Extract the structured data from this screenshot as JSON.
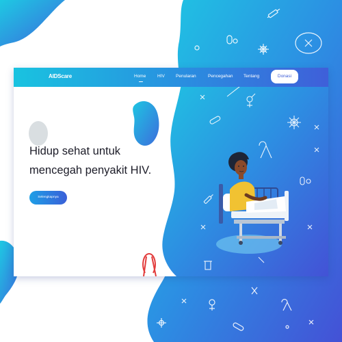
{
  "navbar": {
    "logo": "AIDScare",
    "items": [
      {
        "label": "Home"
      },
      {
        "label": "HIV"
      },
      {
        "label": "Penularan"
      },
      {
        "label": "Pencegahan"
      },
      {
        "label": "Tentang"
      }
    ],
    "donate_label": "Donasi"
  },
  "hero": {
    "headline_line1": "Hidup sehat untuk",
    "headline_line2": "mencegah penyakit HIV.",
    "cta_label": "Selengkapnya"
  },
  "colors": {
    "primary_gradient_start": "#19c3e0",
    "primary_gradient_end": "#3f5fd9",
    "ribbon_red": "#e23b3b",
    "text_dark": "#1c1c28"
  },
  "icons": [
    "ribbon-icon",
    "pill-icon",
    "virus-icon",
    "syringe-icon",
    "gender-icon",
    "capsule-icon",
    "medicine-bottle-icon",
    "hospital-patient-illustration"
  ]
}
